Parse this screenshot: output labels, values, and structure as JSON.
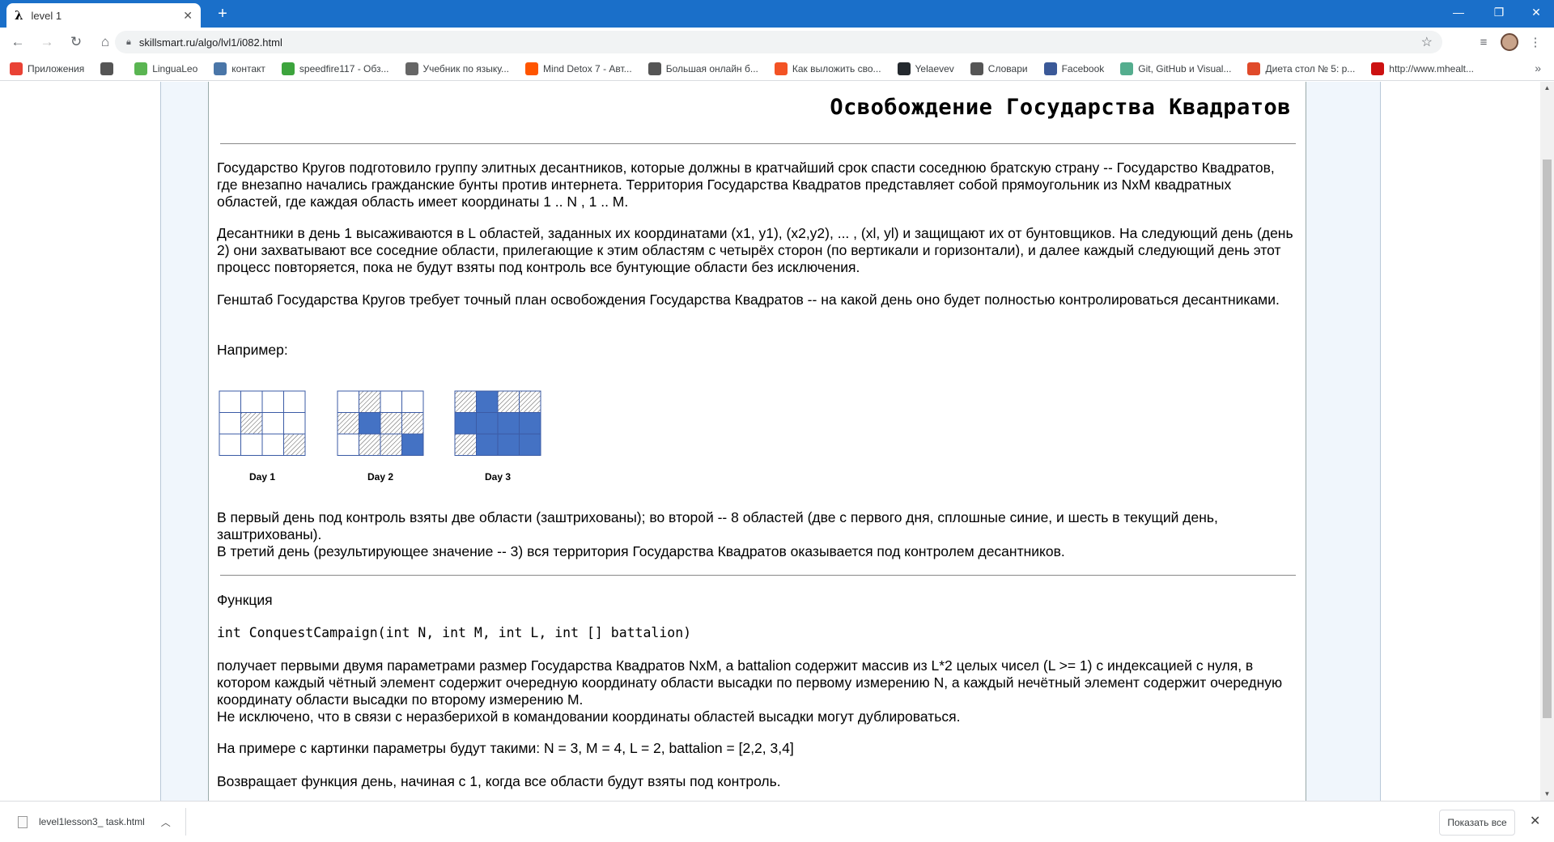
{
  "browser": {
    "tab_title": "level 1",
    "tab_icon": "λ",
    "url": "skillsmart.ru/algo/lvl1/i082.html",
    "bookmarks": [
      {
        "label": "Приложения",
        "icon": "apps-grid-icon",
        "color": "#e94235"
      },
      {
        "label": "",
        "icon": "globe-icon",
        "color": "#555555"
      },
      {
        "label": "LinguaLeo",
        "icon": "lingualeo-icon",
        "color": "#5ab552"
      },
      {
        "label": "контакт",
        "icon": "vk-icon",
        "color": "#4a76a8"
      },
      {
        "label": "speedfire117 - Обз...",
        "icon": "speedfire-icon",
        "color": "#3da43d"
      },
      {
        "label": "Учебник по языку...",
        "icon": "mail-icon",
        "color": "#666666"
      },
      {
        "label": "Mind Detox 7 - Авт...",
        "icon": "soundcloud-icon",
        "color": "#ff5500"
      },
      {
        "label": "Большая онлайн б...",
        "icon": "globe-icon",
        "color": "#555555"
      },
      {
        "label": "Как выложить сво...",
        "icon": "windows-icon",
        "color": "#f35325"
      },
      {
        "label": "Yelaevev",
        "icon": "github-icon",
        "color": "#24292e"
      },
      {
        "label": "Словари",
        "icon": "globe-icon",
        "color": "#555555"
      },
      {
        "label": "Facebook",
        "icon": "facebook-icon",
        "color": "#3b5998"
      },
      {
        "label": "Git, GitHub и Visual...",
        "icon": "stepik-icon",
        "color": "#54ad8e"
      },
      {
        "label": "Диета стол № 5: р...",
        "icon": "diet-icon",
        "color": "#e04a2a"
      },
      {
        "label": "http://www.mhealt...",
        "icon": "mh-icon",
        "color": "#cc1111"
      }
    ]
  },
  "page": {
    "title": "Освобождение Государства Квадратов",
    "para1": "Государство Кругов подготовило группу элитных десантников, которые должны в кратчайший срок спасти соседнюю братскую страну -- Государство Квадратов, где внезапно начались гражданские бунты против интернета. Территория Государства Квадратов представляет собой прямоугольник из NxM квадратных областей, где каждая область имеет координаты 1 .. N , 1 .. M.",
    "para2": "Десантники в день 1 высаживаются в L областей, заданных их координатами (x1, y1), (x2,y2), ... , (xl, yl) и защищают их от бунтовщиков. На следующий день (день 2) они захватывают все соседние области, прилегающие к этим областям с четырёх сторон (по вертикали и горизонтали), и далее каждый следующий день этот процесс повторяется, пока не будут взяты под контроль все бунтующие области без исключения.",
    "para3": "Генштаб Государства Кругов требует точный план освобождения Государства Квадратов -- на какой день оно будет полностью контролироваться десантниками.",
    "example_label": "Например:",
    "days": [
      {
        "label": "Day 1",
        "cells": [
          [
            "e",
            "e",
            "e",
            "e"
          ],
          [
            "e",
            "h",
            "e",
            "e"
          ],
          [
            "e",
            "e",
            "e",
            "h"
          ]
        ]
      },
      {
        "label": "Day 2",
        "cells": [
          [
            "e",
            "h",
            "e",
            "e"
          ],
          [
            "h",
            "s",
            "h",
            "h"
          ],
          [
            "e",
            "h",
            "h",
            "s"
          ]
        ]
      },
      {
        "label": "Day 3",
        "cells": [
          [
            "h",
            "s",
            "h",
            "h"
          ],
          [
            "s",
            "s",
            "s",
            "s"
          ],
          [
            "h",
            "s",
            "s",
            "s"
          ]
        ]
      }
    ],
    "para4a": "В первый день под контроль взяты две области (заштрихованы); во второй -- 8 областей (две с первого дня, сплошные синие, и шесть в текущий день, заштрихованы).",
    "para4b": "В третий день (результирующее значение -- 3) вся территория Государства Квадратов оказывается под контролем десантников.",
    "function_label": "Функция",
    "signature": "int ConquestCampaign(int N, int M, int L, int [] battalion)",
    "para5a": "получает первыми двумя параметрами размер Государства Квадратов NxM, а battalion содержит массив из L*2 целых чисел (L >= 1) с индексацией с нуля, в котором каждый чётный элемент содержит очередную координату области высадки по первому измерению N, а каждый нечётный элемент содержит очередную координату области высадки по второму измерению M.",
    "para5b": "Не исключено, что в связи с неразберихой в командовании координаты областей высадки могут дублироваться.",
    "para6": "На примере с картинки параметры будут такими: N = 3, M = 4, L = 2, battalion = [2,2, 3,4]",
    "para7": "Возвращает функция день, начиная с 1, когда все области будут взяты под контроль."
  },
  "downloads": {
    "filename": "level1lesson3_ task.html",
    "show_all": "Показать все"
  },
  "colors": {
    "solid_cell": "#4472c4",
    "hatch_stroke": "#555555",
    "titlebar": "#1a6fc9"
  }
}
